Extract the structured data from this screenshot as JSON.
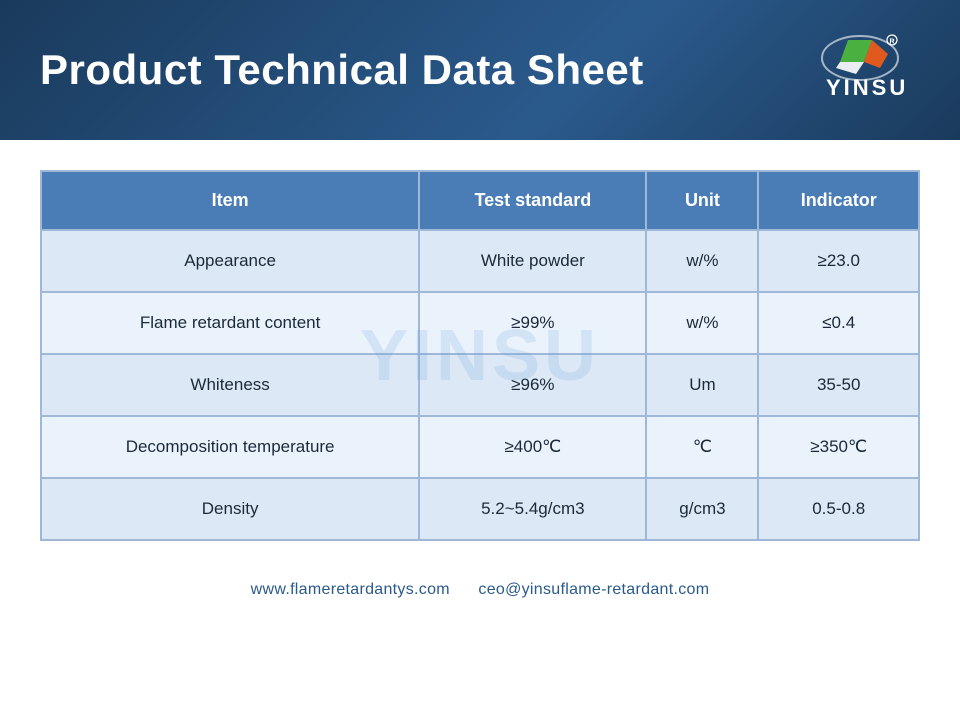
{
  "header": {
    "title": "Product Technical Data Sheet",
    "logo_text": "YINSU"
  },
  "table": {
    "columns": [
      "Item",
      "Test standard",
      "Unit",
      "Indicator"
    ],
    "rows": [
      [
        "Appearance",
        "White powder",
        "w/%",
        "≥23.0"
      ],
      [
        "Flame retardant content",
        "≥99%",
        "w/%",
        "≤0.4"
      ],
      [
        "Whiteness",
        "≥96%",
        "Um",
        "35-50"
      ],
      [
        "Decomposition temperature",
        "≥400℃",
        "℃",
        "≥350℃"
      ],
      [
        "Density",
        "5.2~5.4g/cm3",
        "g/cm3",
        "0.5-0.8"
      ]
    ]
  },
  "watermark": "YINSU",
  "footer": {
    "website": "www.flameretardantys.com",
    "email": "ceo@yinsuflame-retardant.com"
  }
}
